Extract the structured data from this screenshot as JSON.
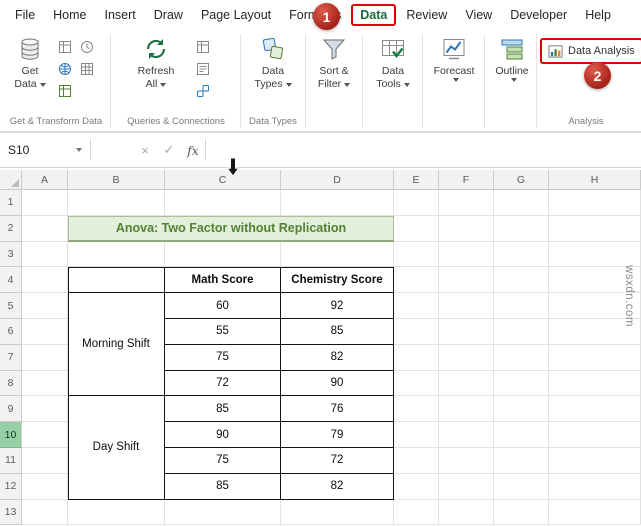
{
  "colors": {
    "annotation_red": "#E00000",
    "excel_green": "#217346",
    "title_text_green": "#538135",
    "title_fill": "#E2EFDA",
    "selected_row_fill": "#97CFA6"
  },
  "menu": {
    "tabs": [
      "File",
      "Home",
      "Insert",
      "Draw",
      "Page Layout",
      "Formulas",
      "Data",
      "Review",
      "View",
      "Developer",
      "Help"
    ],
    "selected_tab": "Data"
  },
  "callouts": {
    "step1": "1",
    "step2": "2"
  },
  "ribbon": {
    "get_data": {
      "line1": "Get",
      "line2": "Data"
    },
    "refresh_all": {
      "line1": "Refresh",
      "line2": "All"
    },
    "data_types": {
      "line1": "Data",
      "line2": "Types"
    },
    "sort_filter": {
      "line1": "Sort &",
      "line2": "Filter"
    },
    "data_tools": {
      "line1": "Data",
      "line2": "Tools"
    },
    "forecast": {
      "line1": "Forecast",
      "line2": ""
    },
    "outline": {
      "line1": "Outline",
      "line2": ""
    },
    "data_analysis": "Data Analysis",
    "group_labels": {
      "get_transform": "Get & Transform Data",
      "queries": "Queries & Connections",
      "data_types": "Data Types",
      "analysis": "Analysis"
    }
  },
  "formula_bar": {
    "name_box": "S10",
    "cancel_glyph": "×",
    "enter_glyph": "✓",
    "fx_glyph": "fx"
  },
  "sheet": {
    "column_headers": [
      "A",
      "B",
      "C",
      "D",
      "E",
      "F",
      "G",
      "H"
    ],
    "row_count": 13,
    "selected_row": 10,
    "title": "Anova: Two Factor without Replication",
    "table": {
      "headers": [
        "Math Score",
        "Chemistry Score"
      ],
      "groups": [
        {
          "label": "Morning Shift",
          "values": [
            [
              60,
              92
            ],
            [
              55,
              85
            ],
            [
              75,
              82
            ],
            [
              72,
              90
            ]
          ]
        },
        {
          "label": "Day Shift",
          "values": [
            [
              85,
              76
            ],
            [
              90,
              79
            ],
            [
              75,
              72
            ],
            [
              85,
              82
            ]
          ]
        }
      ]
    }
  },
  "watermark": "wsxdn.com"
}
